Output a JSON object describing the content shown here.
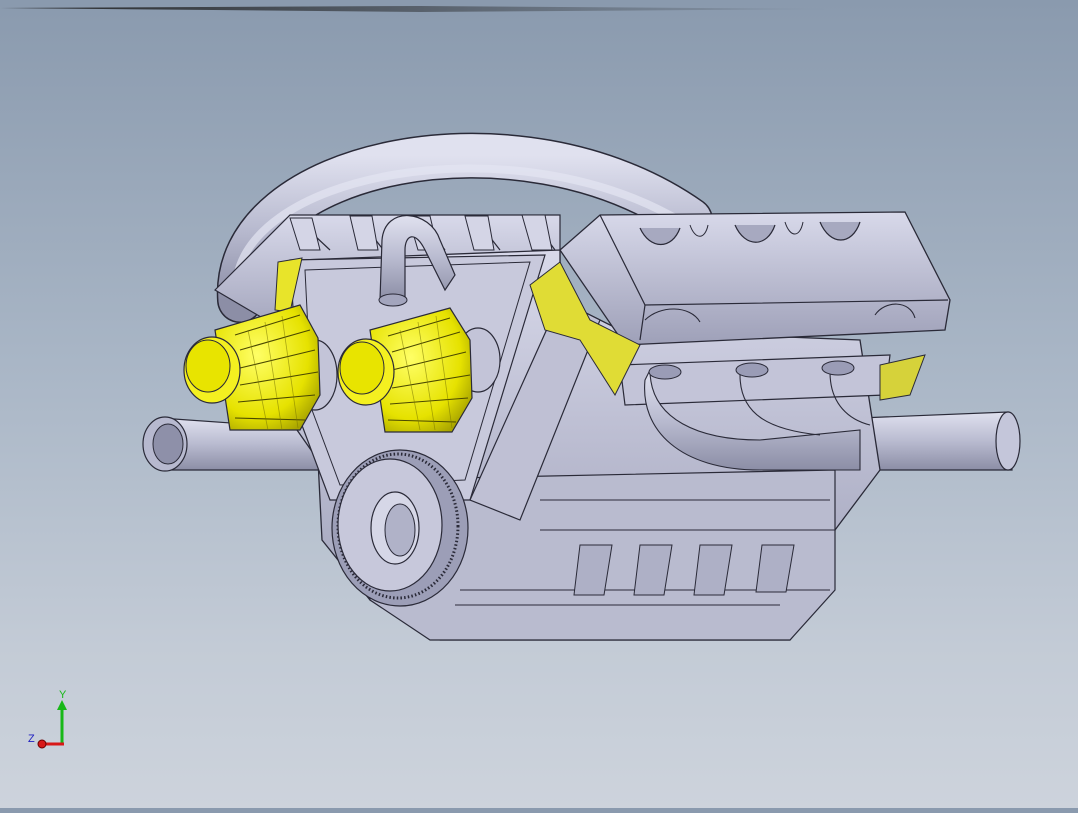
{
  "viewport": {
    "background_top": "#8a9aae",
    "background_bottom": "#cdd3dc"
  },
  "model": {
    "body_color": "#c6c8dc",
    "edge_color": "#2a2a38",
    "highlight_color": "#f2f022",
    "highlight_shadow": "#b9b500"
  },
  "triad": {
    "y_label": "Y",
    "z_label": "Z",
    "y_color": "#18b818",
    "x_color": "#d81818",
    "z_color": "#2020c0"
  }
}
